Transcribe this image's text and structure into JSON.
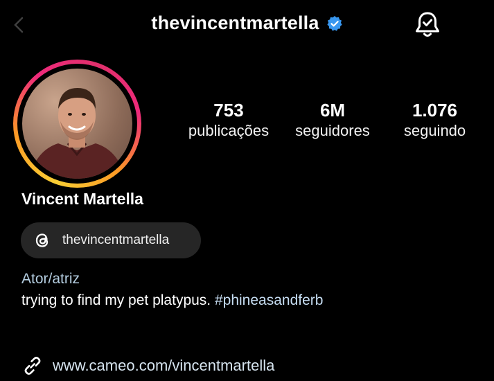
{
  "header": {
    "username": "thevincentmartella",
    "verified_color": "#3897f0"
  },
  "profile": {
    "avatar_ring_colors": [
      "#f9ce34",
      "#ee2a7b",
      "#e1306c"
    ],
    "full_name": "Vincent Martella"
  },
  "stats": [
    {
      "value": "753",
      "label": "publicações"
    },
    {
      "value": "6M",
      "label": "seguidores"
    },
    {
      "value": "1.076",
      "label": "seguindo"
    }
  ],
  "threads": {
    "handle": "thevincentmartella",
    "icon": "threads-icon"
  },
  "bio": {
    "category": "Ator/atriz",
    "text": "trying to find my pet platypus. ",
    "hashtag": "#phineasandferb"
  },
  "link": {
    "icon": "link-icon",
    "url": "www.cameo.com/vincentmartella"
  }
}
